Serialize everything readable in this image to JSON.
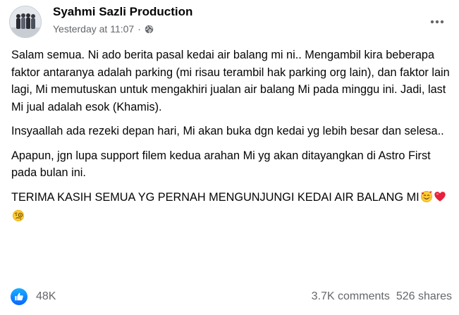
{
  "post": {
    "author": "Syahmi Sazli Production",
    "timestamp": "Yesterday at 11:07",
    "separator": "·",
    "audience_icon": "globe-icon",
    "more_icon": "more-horizontal-icon",
    "paragraphs": {
      "p1": "Salam semua. Ni ado berita pasal kedai air balang mi ni.. Mengambil kira beberapa faktor antaranya adalah parking (mi risau terambil hak parking org lain), dan faktor lain lagi, Mi memutuskan untuk mengakhiri jualan air balang Mi pada minggu ini. Jadi, last Mi jual adalah esok (Khamis).",
      "p2": "Insyaallah ada rezeki depan hari, Mi akan buka dgn kedai yg lebih besar dan selesa..",
      "p3": "Apapun, jgn lupa support filem kedua arahan Mi yg akan ditayangkan di Astro First pada bulan ini.",
      "p4": "TERIMA KASIH SEMUA YG PERNAH MENGUNJUNGI KEDAI AIR BALANG MI"
    },
    "emojis": [
      "smiling-face-with-hearts-emoji",
      "red-heart-emoji",
      "face-with-monocle-emoji"
    ]
  },
  "footer": {
    "reaction_icon": "like-icon",
    "reaction_count": "48K",
    "comments": "3.7K comments",
    "shares": "526 shares"
  },
  "colors": {
    "text_primary": "#050505",
    "text_secondary": "#65676b",
    "like_blue": "#0866ff"
  }
}
